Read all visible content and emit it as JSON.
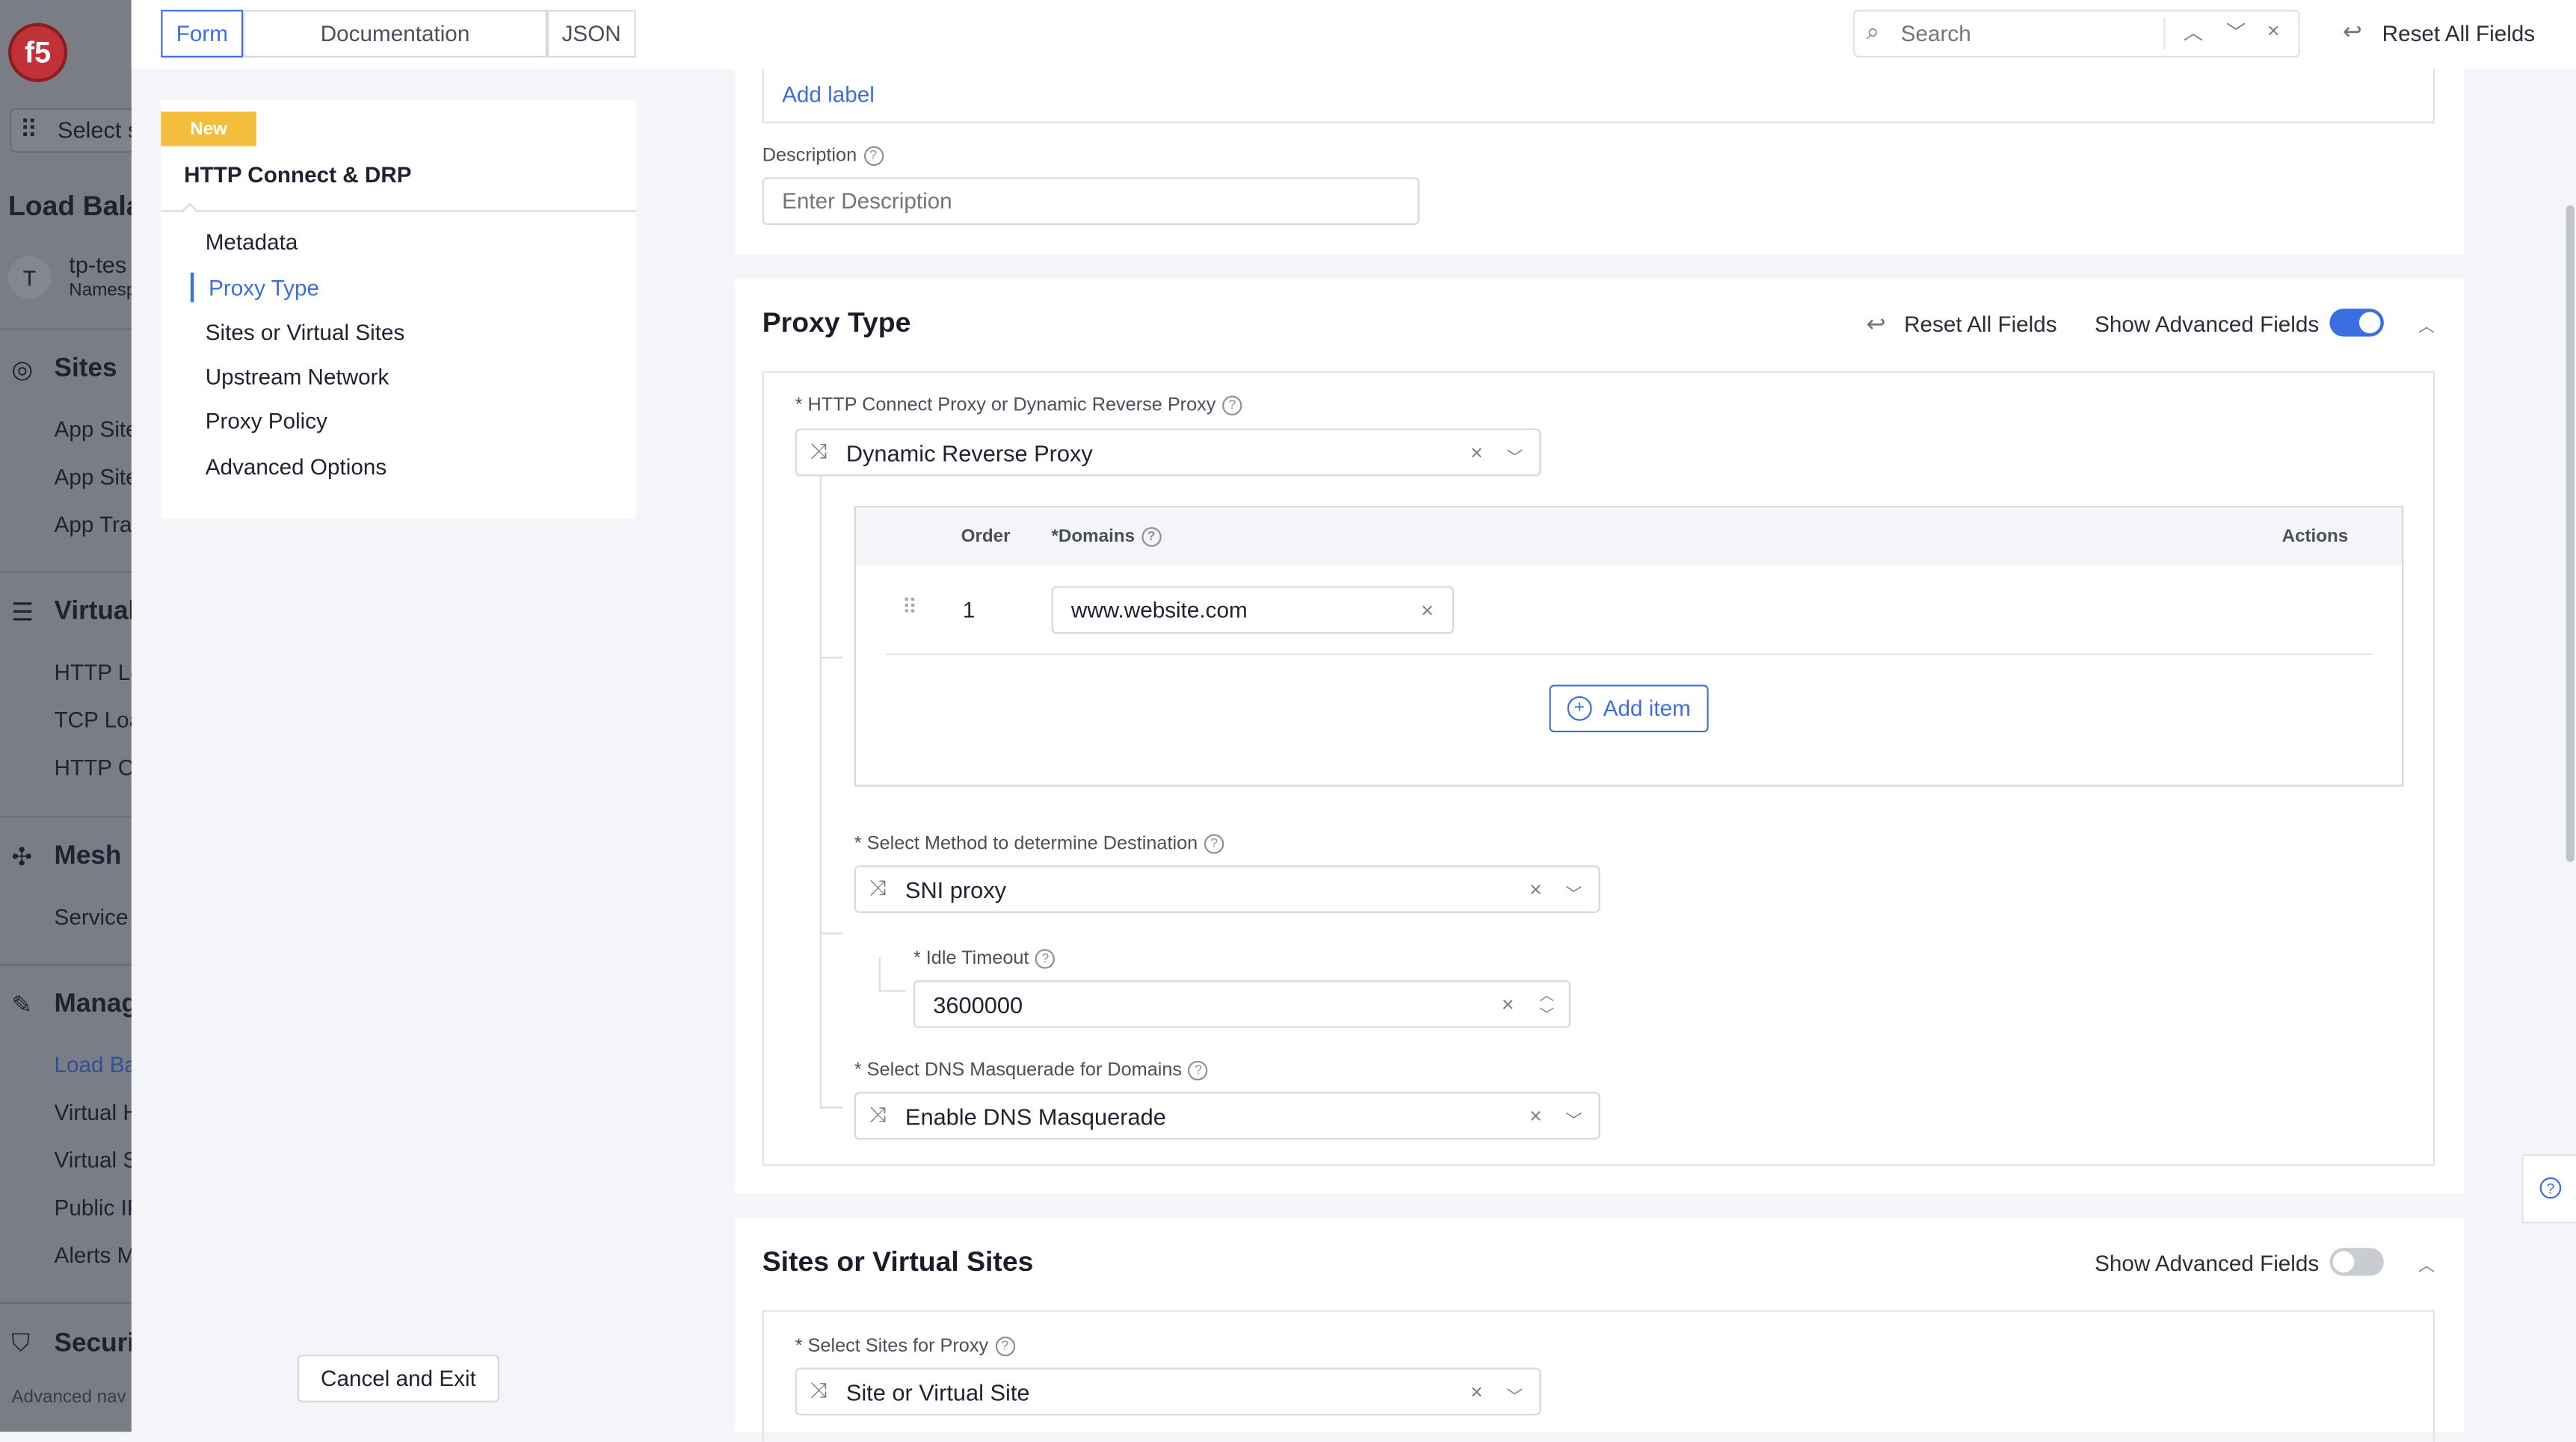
{
  "topbar": {
    "tabs": [
      {
        "label": "Form",
        "active": true
      },
      {
        "label": "Documentation",
        "active": false
      },
      {
        "label": "JSON",
        "active": false
      }
    ],
    "search_placeholder": "Search",
    "reset_all_label": "Reset All Fields"
  },
  "leftnav": {
    "select_label": "Select s",
    "section_title": "Load Bala",
    "namespace_initial": "T",
    "namespace_name": "tp-tes",
    "namespace_sub": "Namesp",
    "groups": [
      {
        "title": "Sites",
        "items": [
          "App Site",
          "App Site",
          "App Tra"
        ]
      },
      {
        "title": "Virtual",
        "items": [
          "HTTP Lo",
          "TCP Loa",
          "HTTP C"
        ]
      },
      {
        "title": "Mesh",
        "items": [
          "Service"
        ]
      },
      {
        "title": "Manag",
        "items": [
          "Load Ba",
          "Virtual H",
          "Virtual S",
          "Public IP",
          "Alerts M"
        ]
      },
      {
        "title": "Securi",
        "items": []
      }
    ],
    "footer": "Advanced nav"
  },
  "sidebar": {
    "badge": "New",
    "title": "HTTP Connect & DRP",
    "items": [
      "Metadata",
      "Proxy Type",
      "Sites or Virtual Sites",
      "Upstream Network",
      "Proxy Policy",
      "Advanced Options"
    ],
    "active_index": 1,
    "cancel_label": "Cancel and Exit"
  },
  "metadata_section": {
    "add_label": "Add label",
    "description_label": "Description",
    "description_placeholder": "Enter Description"
  },
  "proxy_type": {
    "title": "Proxy Type",
    "reset_label": "Reset All Fields",
    "advanced_label": "Show Advanced Fields",
    "advanced_on": true,
    "proxy_field_label": "* HTTP Connect Proxy or Dynamic Reverse Proxy",
    "proxy_value": "Dynamic Reverse Proxy",
    "table": {
      "headers": {
        "order": "Order",
        "domains": "*Domains",
        "actions": "Actions"
      },
      "rows": [
        {
          "order": "1",
          "domain": "www.website.com"
        }
      ],
      "add_item_label": "Add item"
    },
    "method_label": "* Select Method to determine Destination",
    "method_value": "SNI proxy",
    "idle_label": "* Idle Timeout",
    "idle_value": "3600000",
    "dns_label": "* Select DNS Masquerade for Domains",
    "dns_value": "Enable DNS Masquerade"
  },
  "sites_section": {
    "title": "Sites or Virtual Sites",
    "advanced_label": "Show Advanced Fields",
    "advanced_on": false,
    "field_label": "* Select Sites for Proxy",
    "field_value": "Site or Virtual Site"
  },
  "colors": {
    "accent": "#3b6ee0",
    "badge": "#f2be3c",
    "nav_overlay": "#7b7d86"
  }
}
